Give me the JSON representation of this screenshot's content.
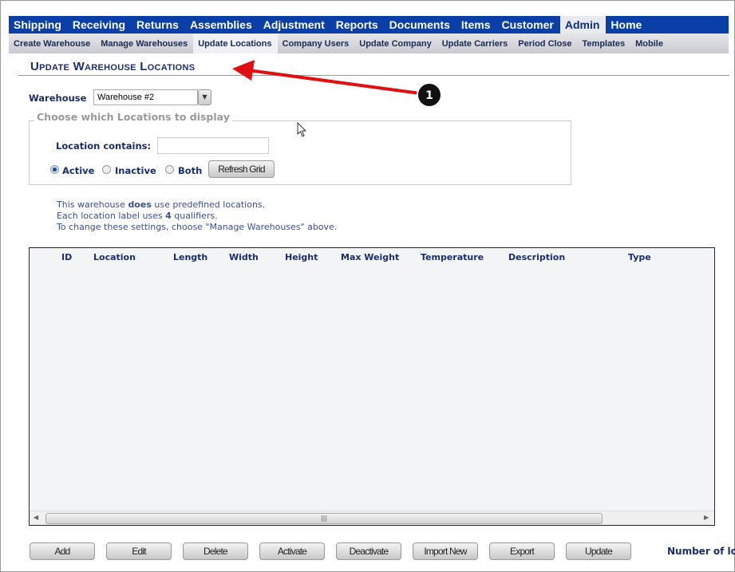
{
  "top_nav": [
    "Shipping",
    "Receiving",
    "Returns",
    "Assemblies",
    "Adjustment",
    "Reports",
    "Documents",
    "Items",
    "Customer",
    "Admin",
    "Home"
  ],
  "top_nav_active": "Admin",
  "sub_nav": [
    "Create Warehouse",
    "Manage Warehouses",
    "Update Locations",
    "Company Users",
    "Update Company",
    "Update Carriers",
    "Period Close",
    "Templates",
    "Mobile"
  ],
  "sub_nav_active": "Update Locations",
  "page_title": "Update Warehouse Locations",
  "warehouse": {
    "label": "Warehouse",
    "value": "Warehouse #2"
  },
  "filter": {
    "legend": "Choose which Locations to display",
    "location_label": "Location contains:",
    "location_value": "",
    "radios": [
      "Active",
      "Inactive",
      "Both"
    ],
    "selected": "Active",
    "refresh": "Refresh Grid"
  },
  "info": {
    "l1a": "This warehouse ",
    "l1b": "does",
    "l1c": " use predefined locations.",
    "l2a": "Each location label uses ",
    "l2b": "4",
    "l2c": " qualifiers.",
    "l3": "To change these settings, choose \"Manage Warehouses\" above."
  },
  "grid": {
    "columns": [
      "ID",
      "Location",
      "Length",
      "Width",
      "Height",
      "Max Weight",
      "Temperature",
      "Description",
      "Type"
    ],
    "rows": []
  },
  "buttons": [
    "Add",
    "Edit",
    "Delete",
    "Activate",
    "Deactivate",
    "Import New",
    "Export",
    "Update"
  ],
  "footer_text": "Number of lo",
  "annotation": {
    "number": "1",
    "color": "#e01010"
  }
}
